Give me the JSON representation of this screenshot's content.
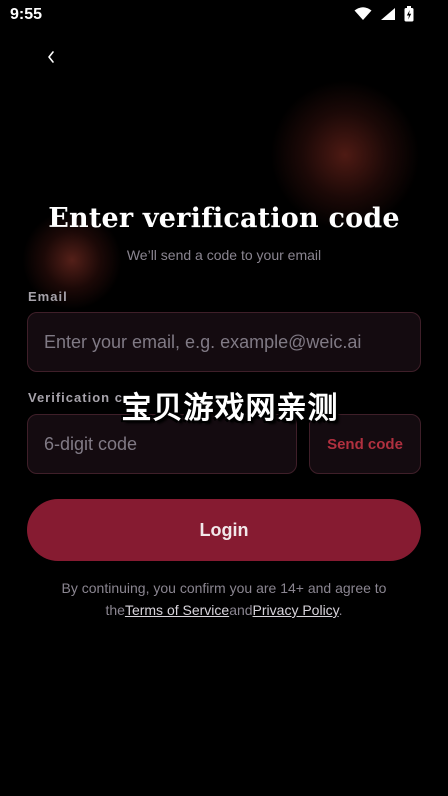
{
  "status_bar": {
    "time": "9:55",
    "icons": [
      "wifi-icon",
      "signal-icon",
      "battery-icon"
    ]
  },
  "header": {
    "back_glyph": "‹",
    "title": "Enter verification code",
    "subtitle": "We’ll send a code to your email"
  },
  "form": {
    "email_label": "Email",
    "email_placeholder": "Enter your email, e.g. example@weic.ai",
    "email_value": "",
    "code_label": "Verification code",
    "code_placeholder": "6-digit code",
    "code_value": "",
    "send_code_label": "Send code",
    "login_label": "Login"
  },
  "legal": {
    "prefix": "By continuing, you confirm you are 14+ and agree to the",
    "terms_link": "Terms of Service",
    "conjunction": "and",
    "privacy_link": "Privacy Policy",
    "suffix": "."
  },
  "overlay": {
    "watermark": "宝贝游戏网亲测"
  },
  "colors": {
    "background": "#000000",
    "accent": "#861b31",
    "send_code_text": "#b0303f",
    "input_bg": "#140b10",
    "input_border": "#3f1f29"
  }
}
